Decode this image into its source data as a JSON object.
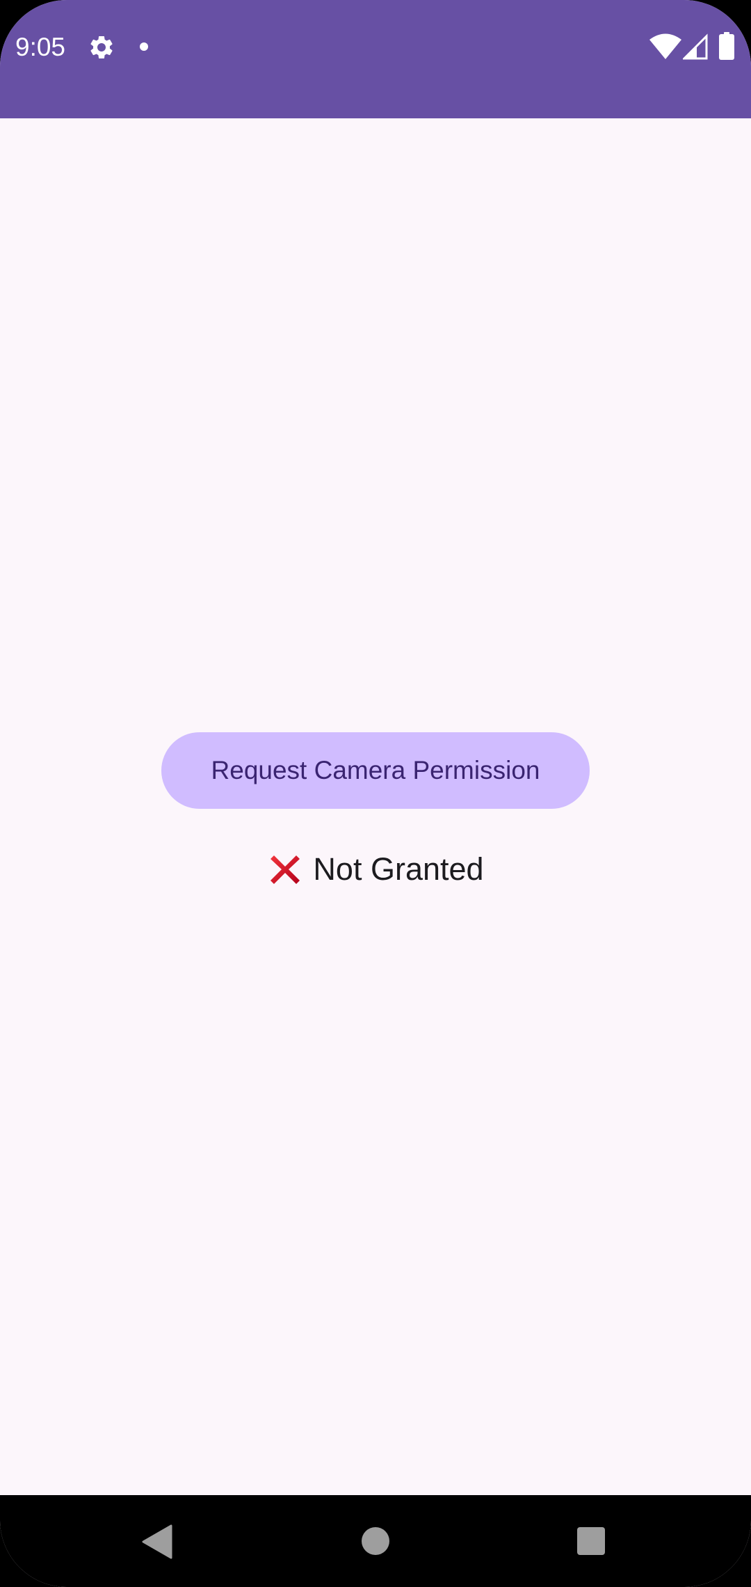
{
  "status_bar": {
    "time": "9:05",
    "icons": [
      "gear-icon",
      "dot-icon",
      "wifi-icon",
      "signal-icon",
      "battery-icon"
    ],
    "background_color": "#6750A4"
  },
  "main": {
    "request_button_label": "Request Camera Permission",
    "permission_status_icon": "cross-mark-icon",
    "permission_status_text": "Not Granted",
    "button_color": "#D0BCFF",
    "button_text_color": "#3A2471",
    "background_color": "#FCF6FB"
  },
  "nav_bar": {
    "icons": [
      "back-icon",
      "home-icon",
      "recents-icon"
    ]
  }
}
